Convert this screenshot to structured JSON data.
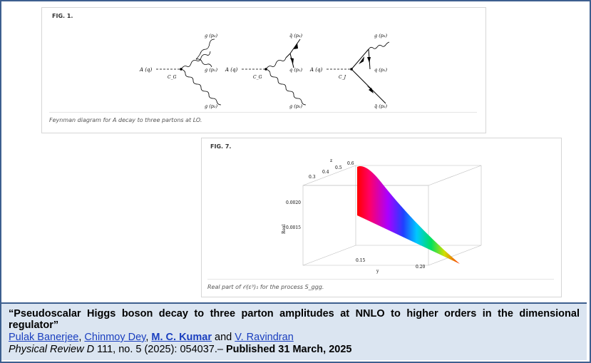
{
  "figure1": {
    "label": "FIG. 1.",
    "caption": "Feynman diagram for A decay to three partons at LO.",
    "diagrams": [
      {
        "in": "A (q)",
        "vertex": "C_G",
        "out_top": "g (p₃)",
        "out_mid": "g (p₁)",
        "out_bot": "g (p₂)"
      },
      {
        "in": "A (q)",
        "vertex": "C_G",
        "out_top": "q̄ (p₃)",
        "out_mid": "q (p₁)",
        "out_bot": "g (p₂)"
      },
      {
        "in": "A (q)",
        "vertex": "C_J",
        "out_top": "g (p₃)",
        "out_mid": "q (p₁)",
        "out_bot": "q̄ (p₂)"
      }
    ]
  },
  "figure7": {
    "label": "FIG. 7.",
    "caption": "Real part of 𝒪(ε³)₁ for the process S_ggg.",
    "axes": {
      "z_label": "z",
      "z_ticks": [
        "0.3",
        "0.4",
        "0.5",
        "0.6"
      ],
      "vertical_label": "Real",
      "vertical_ticks": [
        "0.0020",
        "0.0015"
      ],
      "y_label": "y",
      "y_ticks": [
        "0.15",
        "0.20"
      ]
    }
  },
  "citation": {
    "title": "“Pseudoscalar Higgs boson decay to three parton amplitudes at NNLO to higher orders in the dimensional regulator”",
    "authors": [
      {
        "name": "Pulak Banerjee",
        "bold": false
      },
      {
        "name": "Chinmoy Dey",
        "bold": false
      },
      {
        "name": "M. C. Kumar",
        "bold": true
      },
      {
        "name": "V. Ravindran",
        "bold": false
      }
    ],
    "author_sep1": ", ",
    "author_sep2": ", ",
    "author_and": " and ",
    "journal_name": "Physical Review D",
    "journal_details": " 111, no. 5 (2025): 054037.– ",
    "published": "Published 31 March, 2025"
  }
}
